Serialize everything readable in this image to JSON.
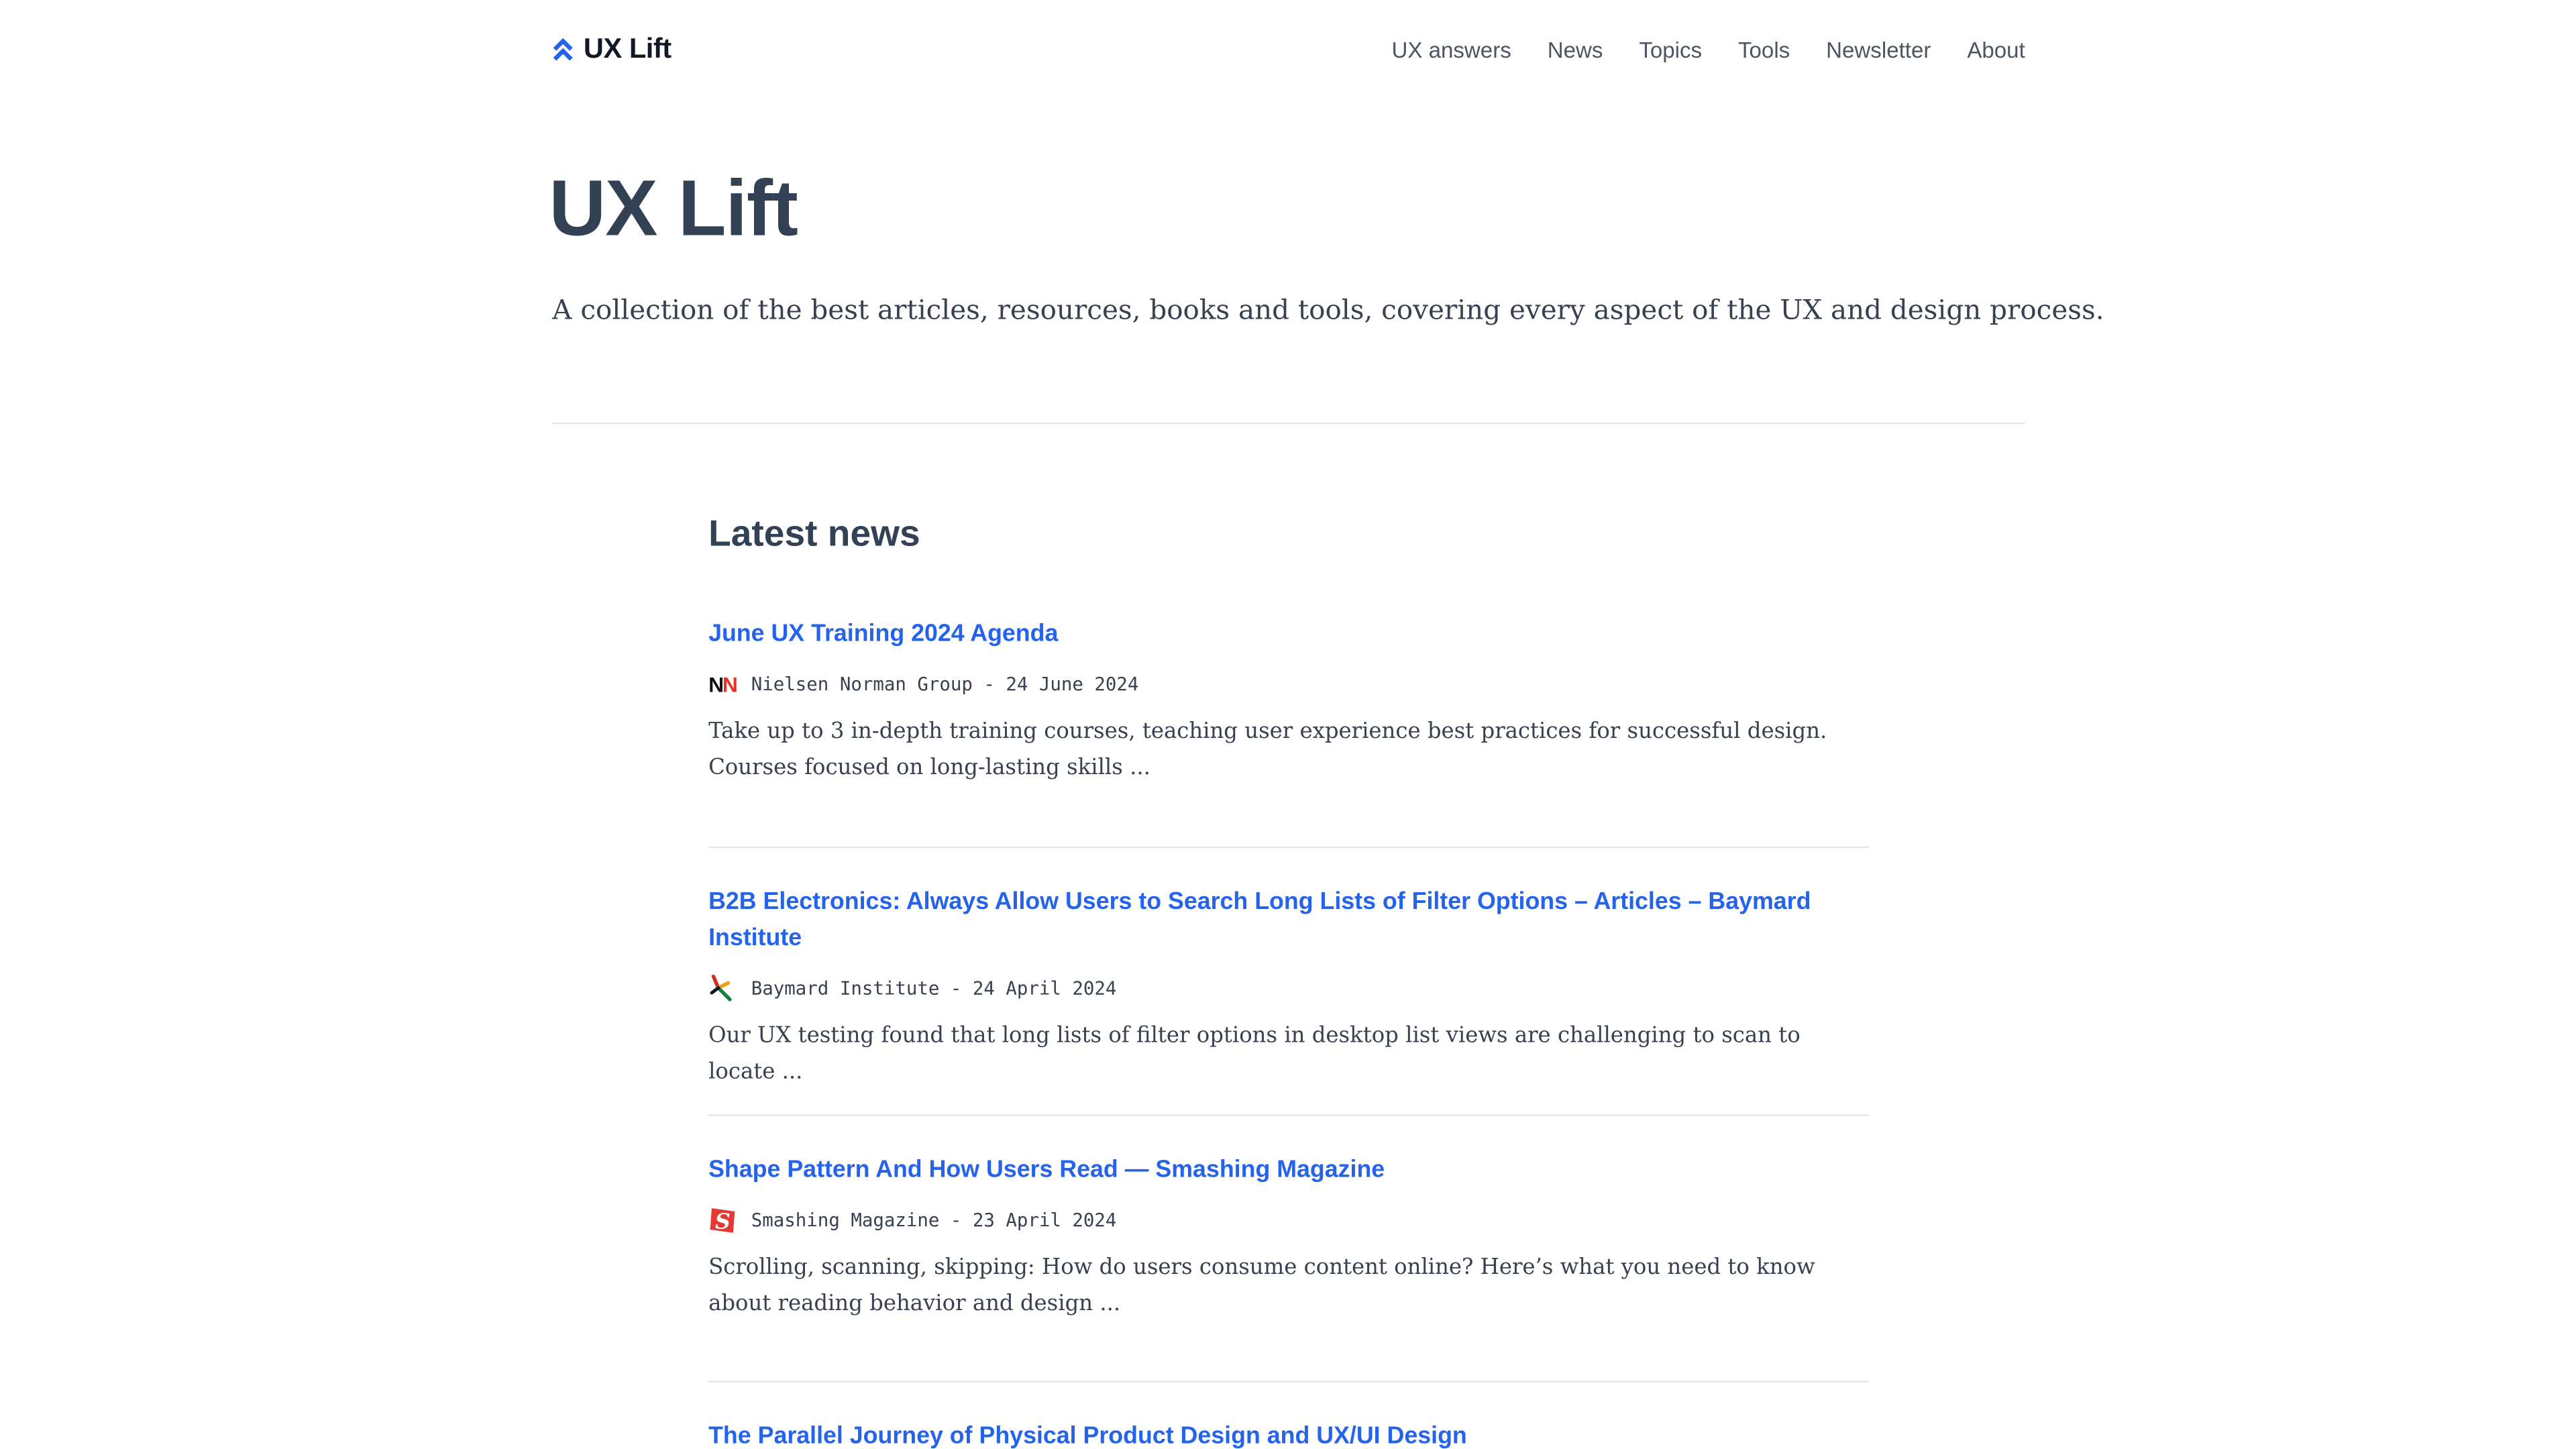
{
  "header": {
    "brand": "UX Lift",
    "nav": [
      "UX answers",
      "News",
      "Topics",
      "Tools",
      "Newsletter",
      "About"
    ]
  },
  "hero": {
    "title": "UX Lift",
    "description": "A collection of the best articles, resources, books and tools, covering every aspect of the UX and design process."
  },
  "news": {
    "heading": "Latest news",
    "articles": [
      {
        "title": "June UX Training 2024 Agenda",
        "source": "Nielsen Norman Group",
        "date": "24 June 2024",
        "meta": "Nielsen Norman Group - 24 June 2024",
        "excerpt": "Take up to 3 in-depth training courses, teaching user experience best practices for successful design. Courses focused on long-lasting skills ...",
        "icon": "nielsen-norman-logo"
      },
      {
        "title": "B2B Electronics: Always Allow Users to Search Long Lists of Filter Options – Articles – Baymard Institute",
        "source": "Baymard Institute",
        "date": "24 April 2024",
        "meta": "Baymard Institute - 24 April 2024",
        "excerpt": "Our UX testing found that long lists of filter options in desktop list views are challenging to scan to locate ...",
        "icon": "baymard-logo"
      },
      {
        "title": "Shape Pattern And How Users Read — Smashing Magazine",
        "source": "Smashing Magazine",
        "date": "23 April 2024",
        "meta": "Smashing Magazine - 23 April 2024",
        "excerpt": "Scrolling, scanning, skipping: How do users consume content online? Here’s what you need to know about reading behavior and design ...",
        "icon": "smashing-magazine-logo"
      },
      {
        "title": "The Parallel Journey of Physical Product Design and UX/UI Design"
      }
    ]
  },
  "colors": {
    "link": "#2563eb",
    "heading": "#334155",
    "brand_icon": "#2563eb",
    "divider": "#e5e7eb"
  }
}
